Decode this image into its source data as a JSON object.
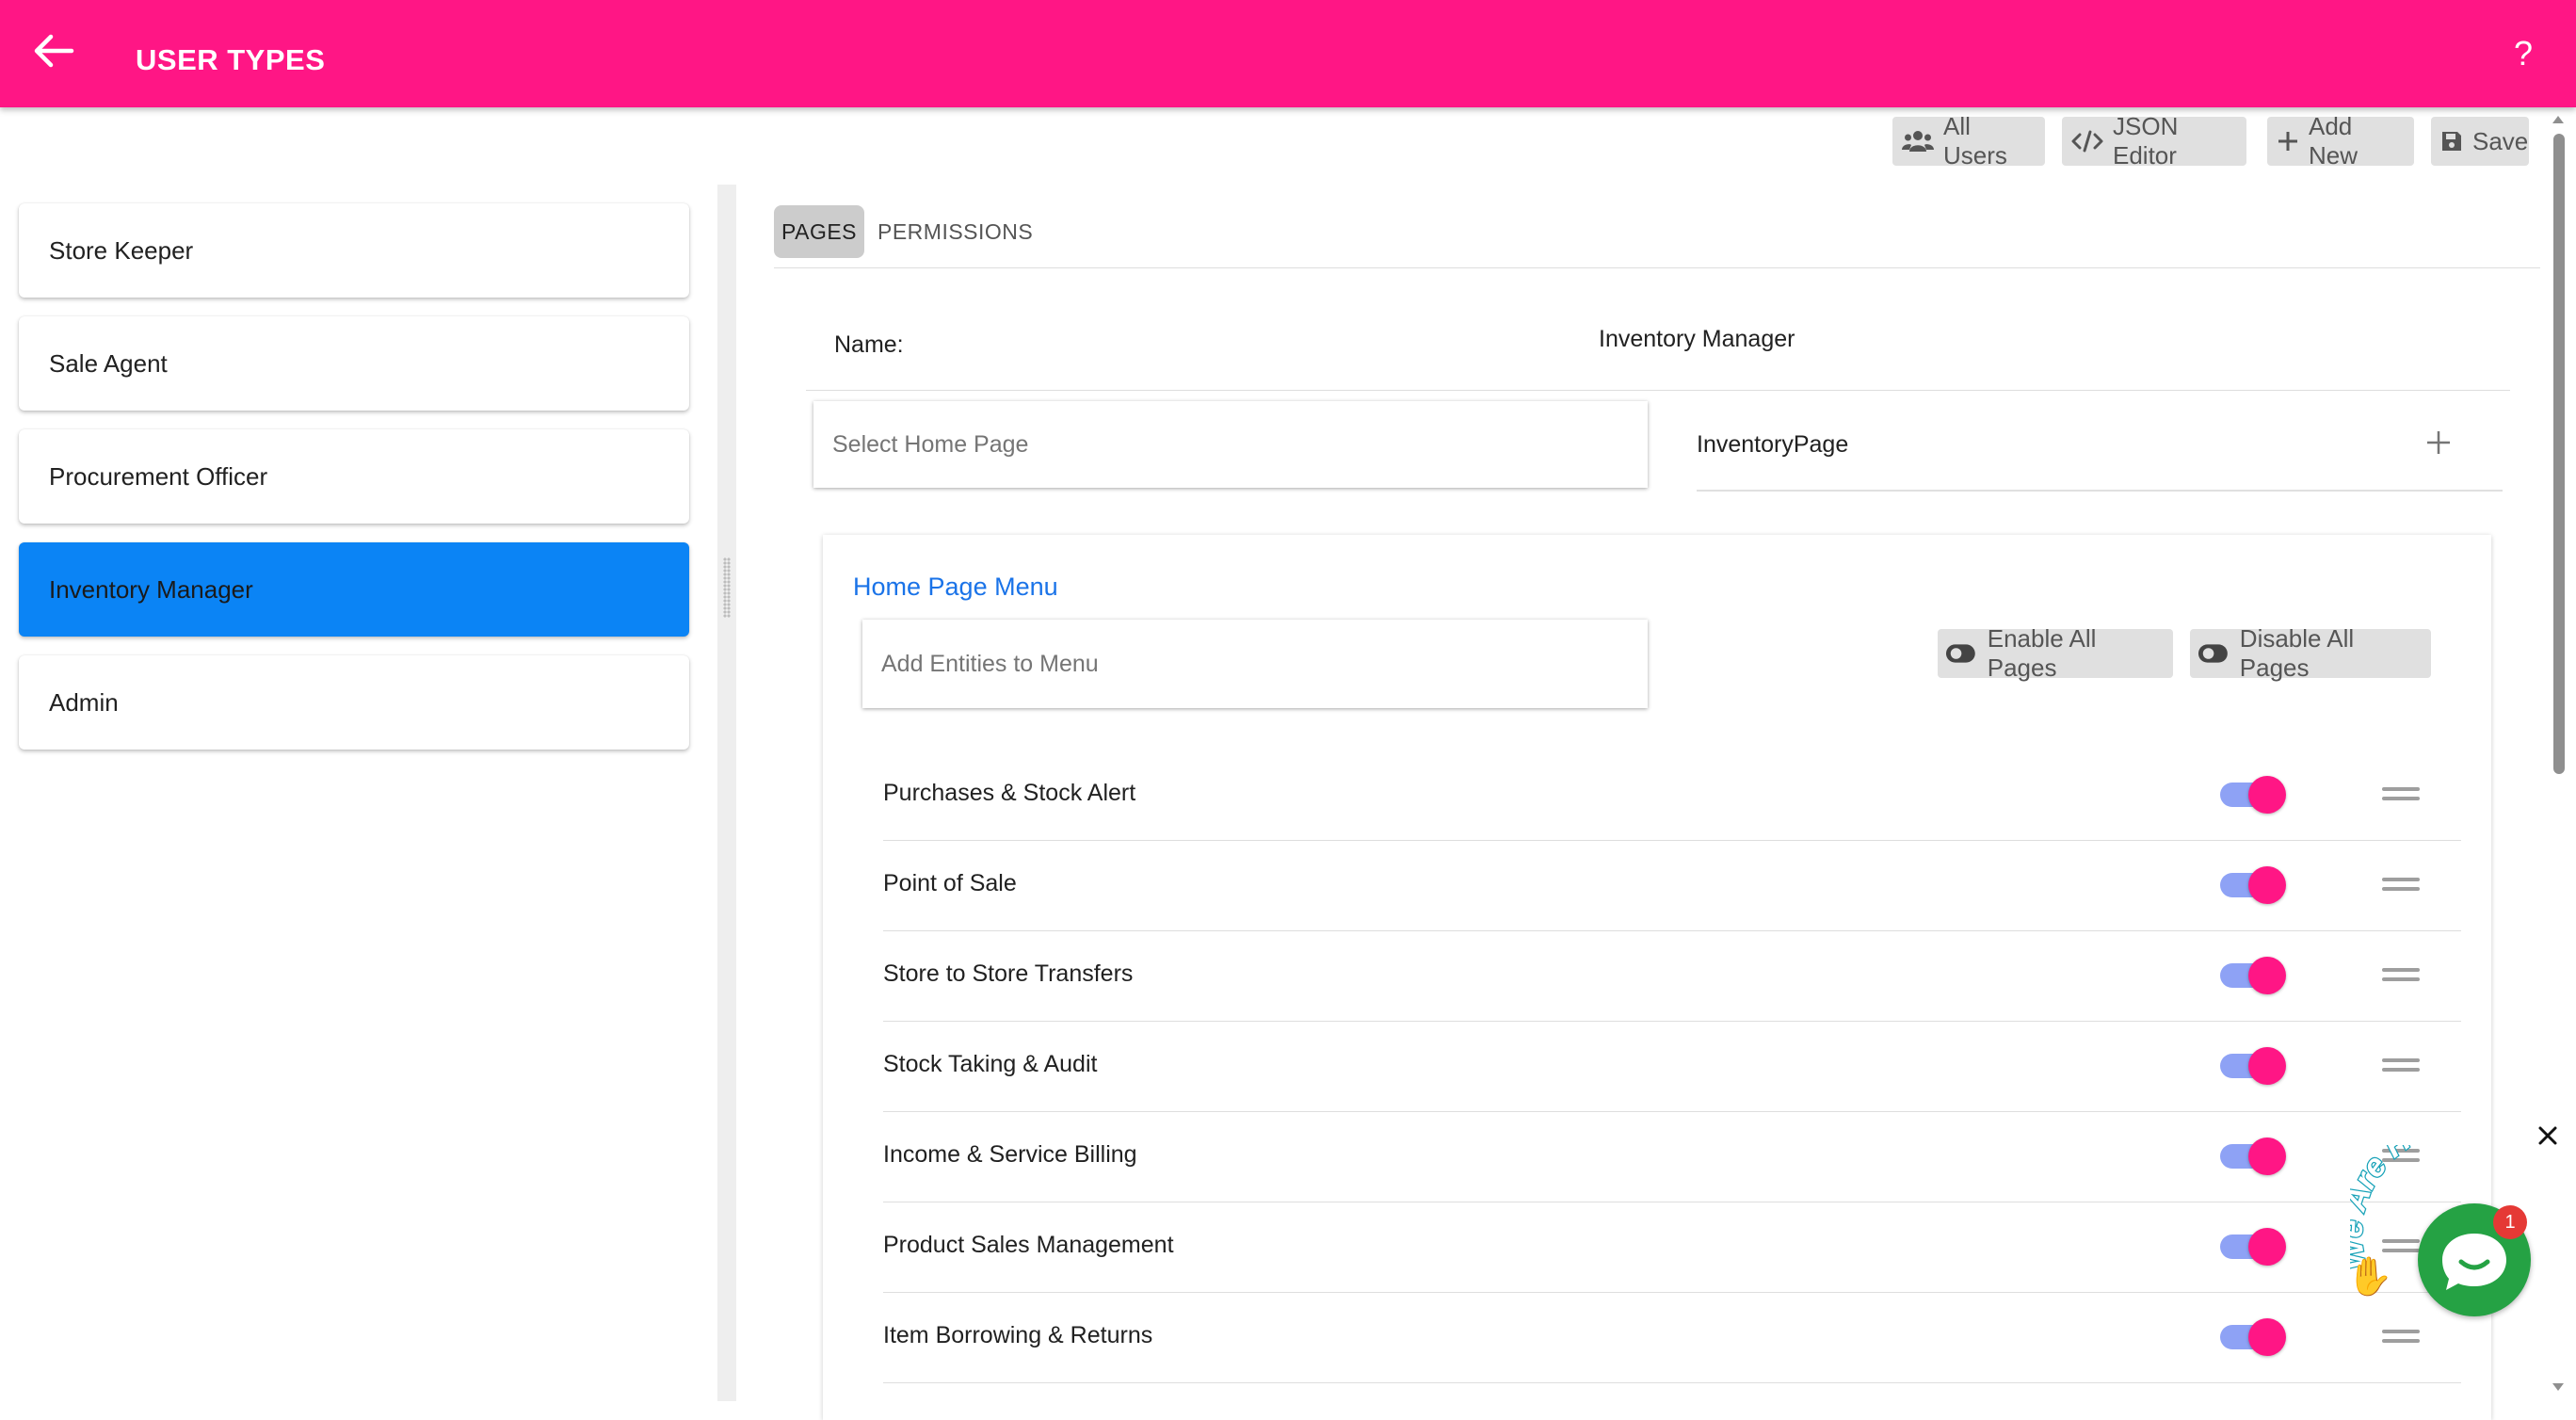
{
  "header": {
    "title": "USER TYPES",
    "help_label": "?",
    "back_icon": "arrow-left-icon"
  },
  "toolbar": {
    "all_users": "All Users",
    "json_editor": "JSON Editor",
    "add_new": "Add New",
    "save": "Save"
  },
  "user_types": [
    {
      "label": "Store Keeper",
      "active": false
    },
    {
      "label": "Sale Agent",
      "active": false
    },
    {
      "label": "Procurement Officer",
      "active": false
    },
    {
      "label": "Inventory Manager",
      "active": true
    },
    {
      "label": "Admin",
      "active": false
    }
  ],
  "tabs": [
    {
      "label": "PAGES",
      "active": true
    },
    {
      "label": "PERMISSIONS",
      "active": false
    }
  ],
  "form": {
    "name_label": "Name:",
    "name_value": "Inventory Manager",
    "home_page_placeholder": "Select Home Page",
    "home_page_value": "InventoryPage"
  },
  "menu": {
    "title": "Home Page Menu",
    "add_placeholder": "Add Entities to Menu",
    "enable_all": "Enable All Pages",
    "disable_all": "Disable All Pages",
    "items": [
      {
        "label": "Purchases & Stock Alert",
        "enabled": true
      },
      {
        "label": "Point of Sale",
        "enabled": true
      },
      {
        "label": "Store to Store Transfers",
        "enabled": true
      },
      {
        "label": "Stock Taking & Audit",
        "enabled": true
      },
      {
        "label": "Income & Service Billing",
        "enabled": true
      },
      {
        "label": "Product Sales Management",
        "enabled": true
      },
      {
        "label": "Item Borrowing & Returns",
        "enabled": true
      }
    ]
  },
  "chat": {
    "greeting": "We Are Here!",
    "badge_count": "1"
  },
  "colors": {
    "header": "#ff1685",
    "active_item": "#0b84f5",
    "switch_thumb": "#ff1685",
    "switch_track": "#8ea2f5",
    "link": "#1a73e8",
    "chat": "#25a244"
  }
}
